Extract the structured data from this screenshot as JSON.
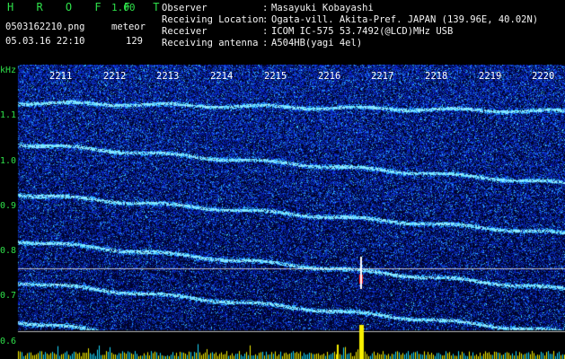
{
  "app": {
    "name": "H R O F F T",
    "version": "1.00"
  },
  "file": {
    "name": "0503162210.png",
    "datetime": "05.03.16 22:10"
  },
  "meteor": {
    "label": "meteor",
    "count": "129"
  },
  "info": {
    "rows": [
      {
        "label": "Observer",
        "value": "Masayuki Kobayashi"
      },
      {
        "label": "Receiving Location",
        "value": "Ogata-vill. Akita-Pref. JAPAN (139.96E, 40.02N)"
      },
      {
        "label": "Receiver",
        "value": "ICOM IC-575 53.7492(@LCD)MHz USB"
      },
      {
        "label": "Receiving antenna",
        "value": "A504HB(yagi 4el)"
      }
    ],
    "colon": ":"
  },
  "axis": {
    "y_unit": "kHz",
    "y_ticks": [
      "1.1",
      "1.0",
      "0.9",
      "0.8",
      "0.7",
      "0.6"
    ],
    "time_ticks": [
      "2211",
      "2212",
      "2213",
      "2214",
      "2215",
      "2216",
      "2217",
      "2218",
      "2219",
      "2220"
    ]
  },
  "colors": {
    "background": "#000000",
    "noise_dark": "#0a1aa0",
    "noise_light": "#2f6fff",
    "trace": "#6ff0ff",
    "label_green": "#2ee04a",
    "bar_yellow": "#f8f000",
    "meteor_red": "#ff2020"
  }
}
